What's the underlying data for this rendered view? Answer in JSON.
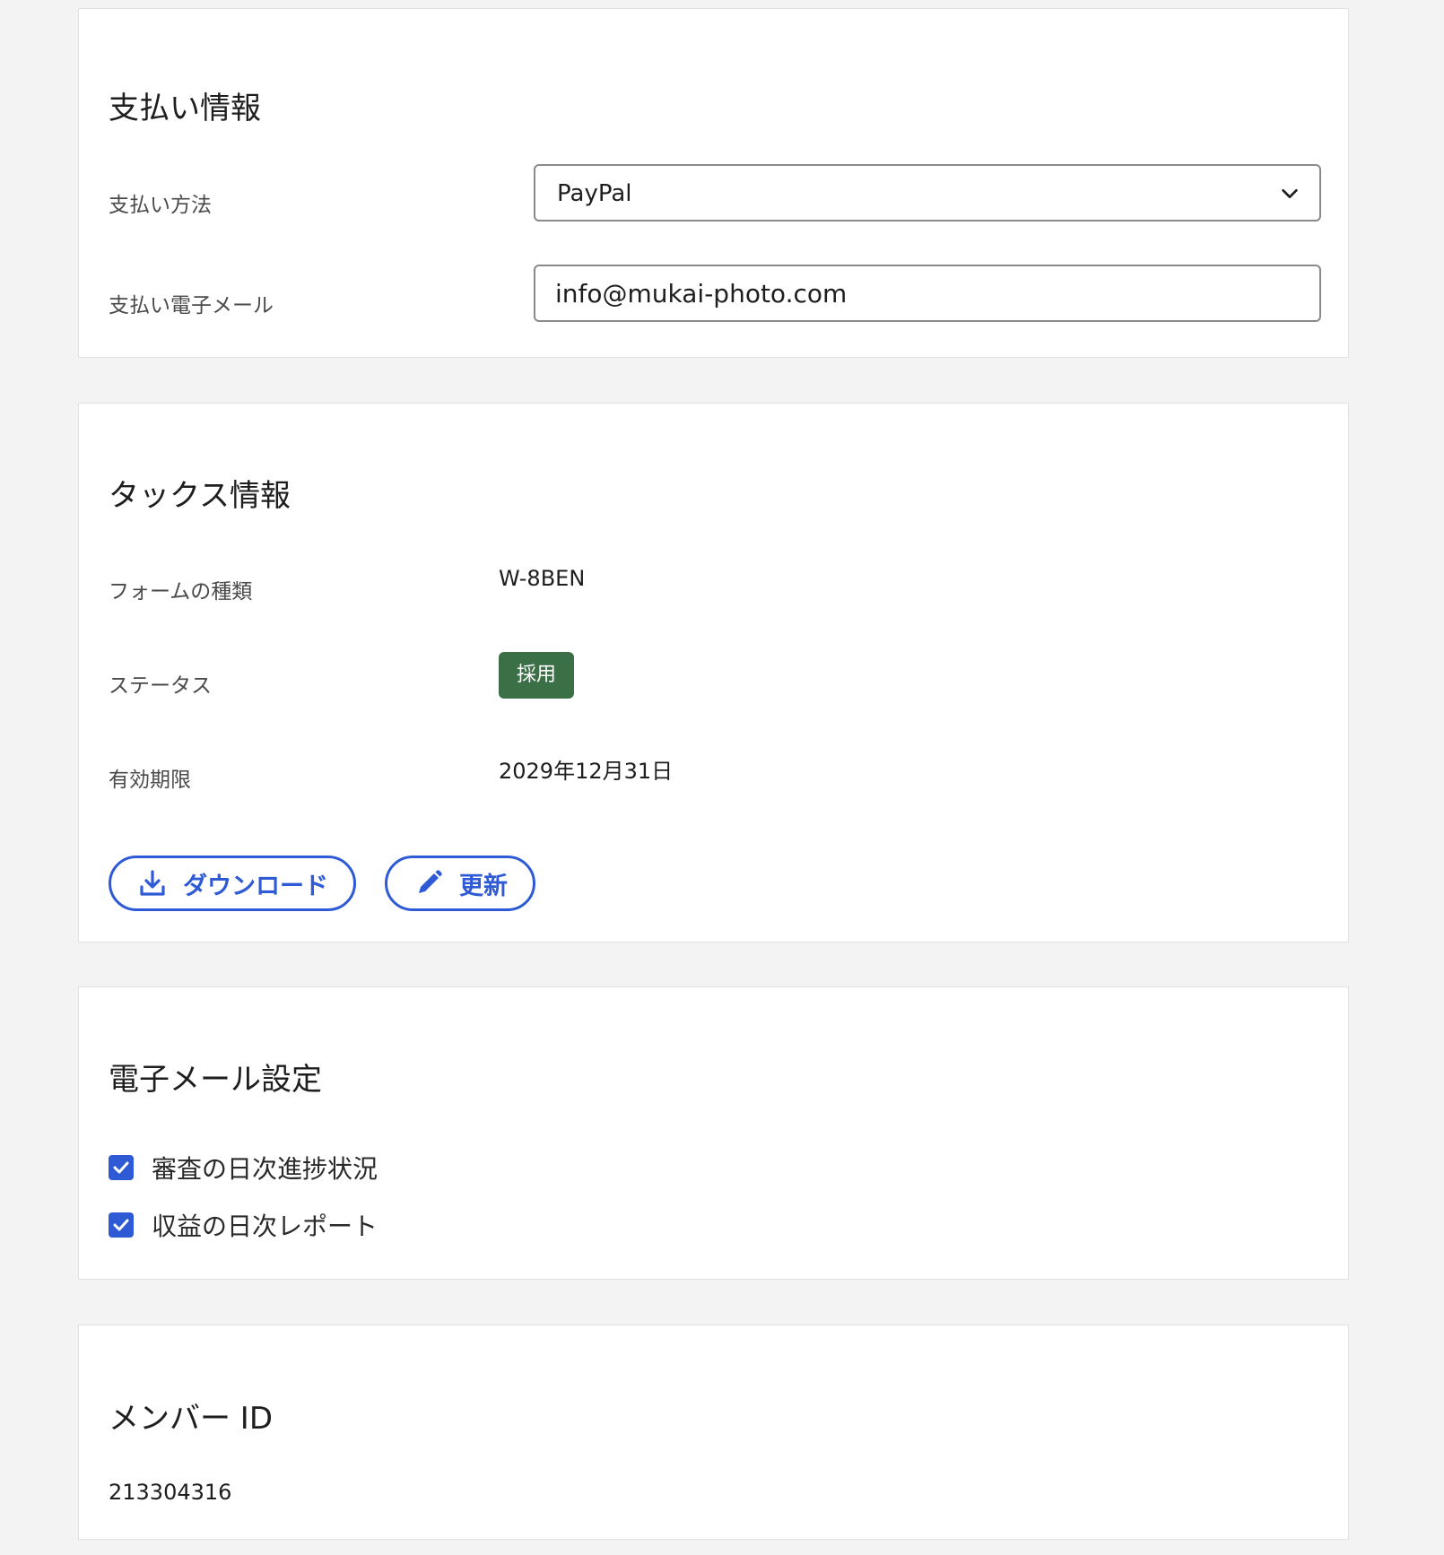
{
  "payment": {
    "title": "支払い情報",
    "method_label": "支払い方法",
    "method_value": "PayPal",
    "email_label": "支払い電子メール",
    "email_value": "info@mukai-photo.com"
  },
  "tax": {
    "title": "タックス情報",
    "form_type_label": "フォームの種類",
    "form_type_value": "W-8BEN",
    "status_label": "ステータス",
    "status_value": "採用",
    "expiry_label": "有効期限",
    "expiry_value": "2029年12月31日",
    "download_label": "ダウンロード",
    "update_label": "更新"
  },
  "email_settings": {
    "title": "電子メール設定",
    "options": [
      {
        "label": "審査の日次進捗状況",
        "checked": true
      },
      {
        "label": "収益の日次レポート",
        "checked": true
      }
    ]
  },
  "member": {
    "title": "メンバー ID",
    "id_value": "213304316"
  },
  "colors": {
    "accent": "#2f5ad6",
    "status_badge": "#3b7047",
    "background": "#f3f3f3"
  },
  "icons": {
    "select": "chevron-down-icon",
    "download": "download-icon",
    "update": "pencil-icon",
    "checkbox": "checkmark-icon"
  }
}
